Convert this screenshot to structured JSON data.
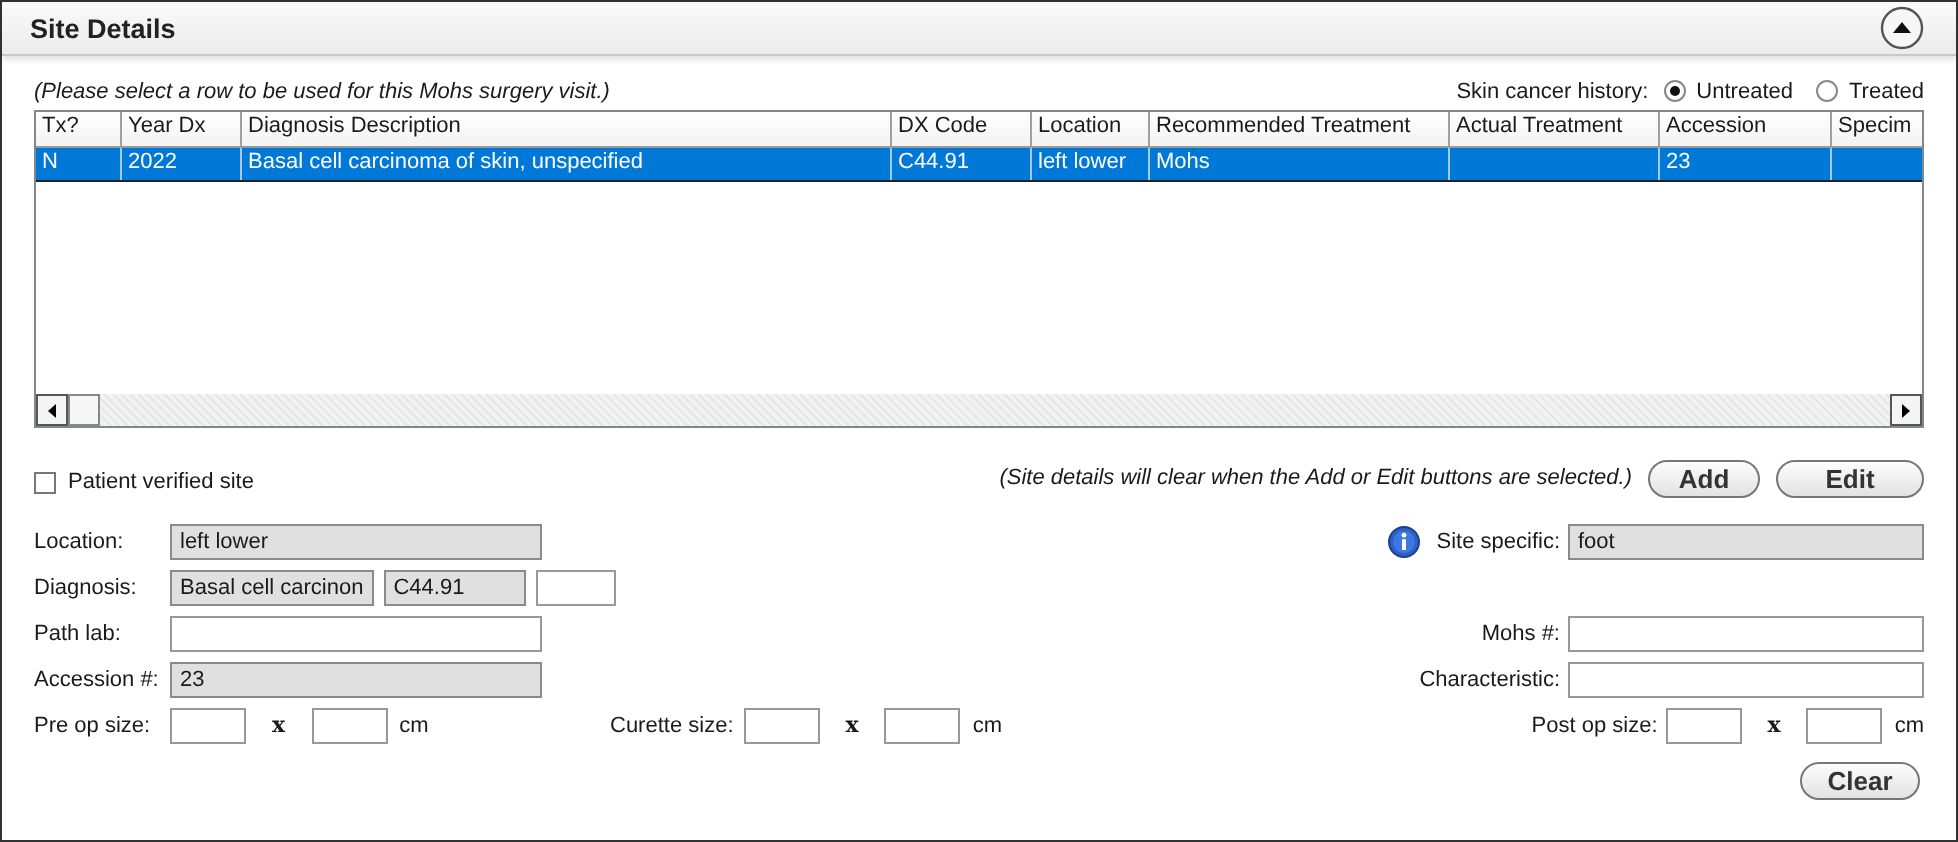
{
  "panel": {
    "title": "Site Details"
  },
  "instruction": "(Please select a row to be used for this Mohs surgery visit.)",
  "skin_cancer_history": {
    "label": "Skin cancer history:",
    "options": [
      {
        "label": "Untreated",
        "selected": true
      },
      {
        "label": "Treated",
        "selected": false
      }
    ]
  },
  "table": {
    "columns": [
      "Tx?",
      "Year Dx",
      "Diagnosis Description",
      "DX Code",
      "Location",
      "Recommended Treatment",
      "Actual Treatment",
      "Accession",
      "Specim"
    ],
    "rows": [
      {
        "selected": true,
        "cells": [
          "N",
          "2022",
          "Basal cell carcinoma of skin, unspecified",
          "C44.91",
          "left lower",
          "Mohs",
          null,
          "23",
          null
        ]
      }
    ]
  },
  "verified": {
    "label": "Patient verified site",
    "checked": false
  },
  "hint": "(Site details will clear when the Add or Edit buttons are selected.)",
  "buttons": [
    "Add",
    "Edit"
  ],
  "rows": [
    {
      "left": {
        "kind": "text",
        "label": "Location:",
        "inputs": [
          {
            "value": "left lower",
            "disabled": true
          }
        ]
      },
      "right": {
        "kind": "text",
        "label": "Site specific:",
        "info": true,
        "inputs": [
          {
            "value": "foot",
            "disabled": true
          }
        ]
      }
    },
    {
      "left": {
        "kind": "text",
        "label": "Diagnosis:",
        "inputs": [
          {
            "value": "Basal cell carcinon",
            "disabled": true
          },
          {
            "value": "C44.91",
            "disabled": true
          },
          {
            "disabled": false
          }
        ]
      }
    },
    {
      "left": {
        "kind": "text",
        "label": "Path lab:",
        "inputs": [
          {
            "disabled": false
          }
        ]
      },
      "right": {
        "kind": "text",
        "label": "Mohs #:",
        "inputs": [
          {
            "disabled": false
          }
        ]
      }
    },
    {
      "left": {
        "kind": "text",
        "label": "Accession #:",
        "inputs": [
          {
            "value": "23",
            "disabled": true
          }
        ]
      },
      "right": {
        "kind": "text",
        "label": "Characteristic:",
        "inputs": [
          {
            "disabled": false
          }
        ]
      }
    },
    {
      "left": {
        "kind": "size",
        "label": "Pre op size:",
        "separator": "x",
        "unit": "cm",
        "inputs": [
          {
            "disabled": false
          },
          {
            "disabled": false
          }
        ]
      },
      "middle": {
        "kind": "size",
        "label": "Curette size:",
        "separator": "x",
        "unit": "cm",
        "inputs": [
          {
            "disabled": false
          },
          {
            "disabled": false
          }
        ]
      },
      "right": {
        "kind": "size",
        "label": "Post op size:",
        "separator": "x",
        "unit": "cm",
        "inputs": [
          {
            "disabled": false
          },
          {
            "disabled": false
          }
        ]
      }
    }
  ],
  "clear_button": "Clear"
}
